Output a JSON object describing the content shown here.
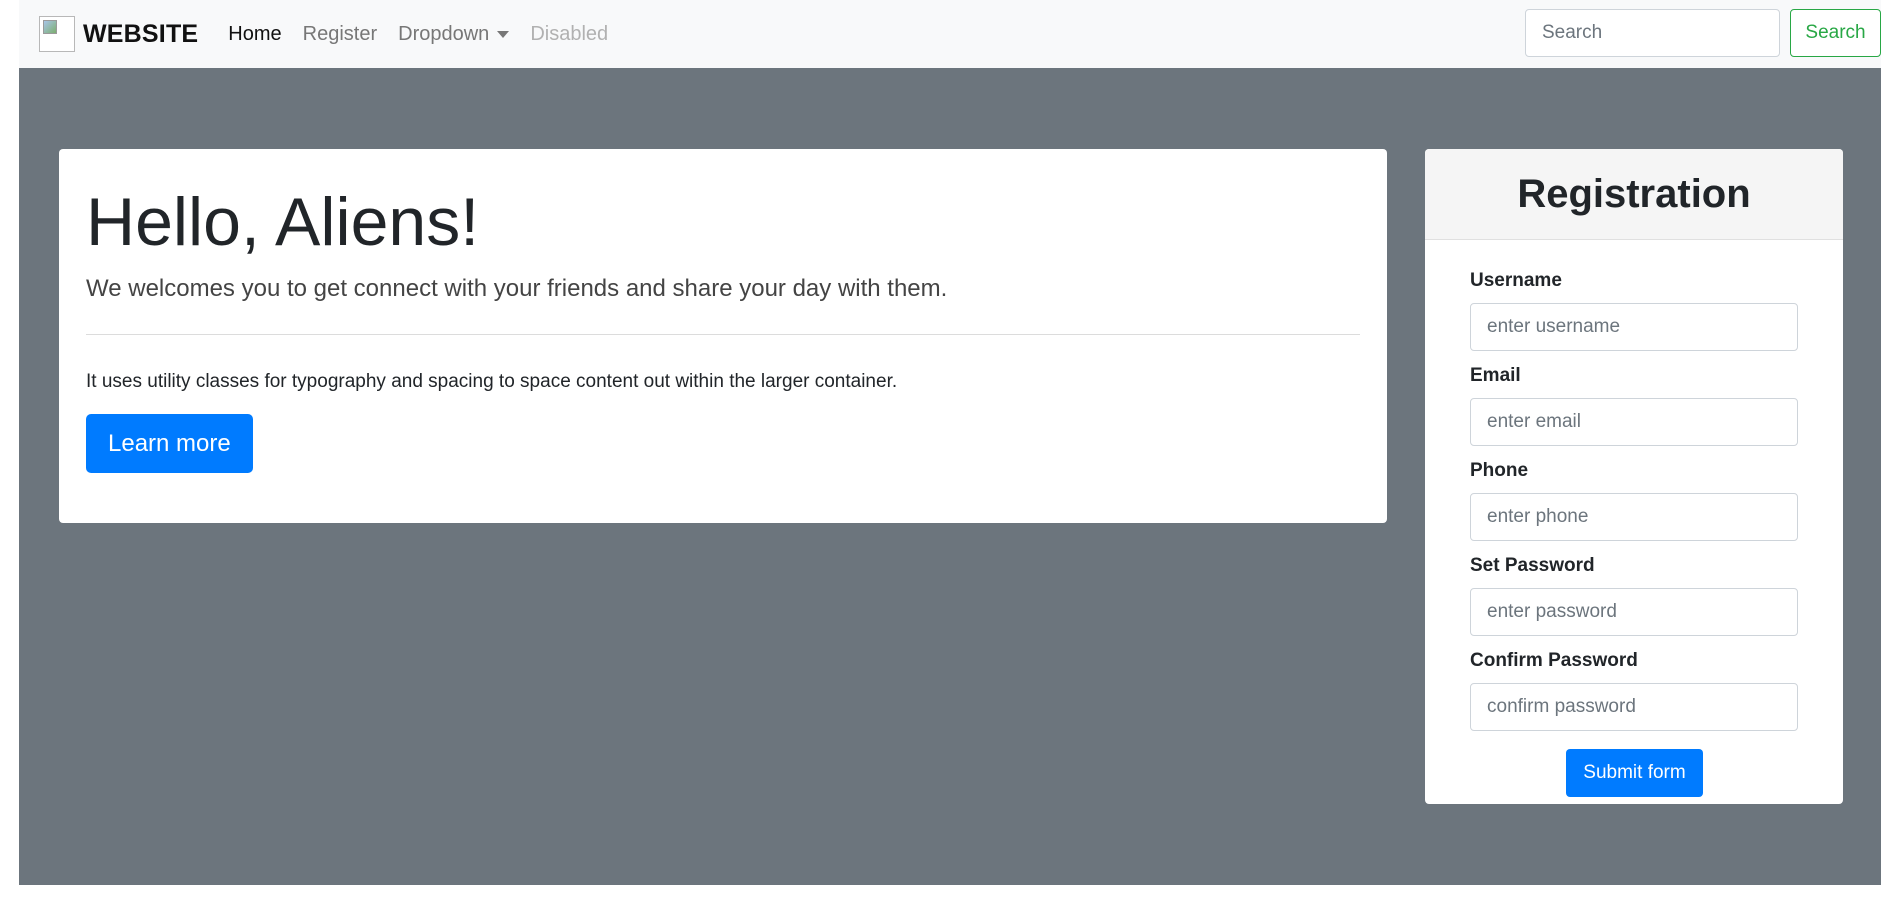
{
  "navbar": {
    "brand": "WEBSITE",
    "links": [
      {
        "label": "Home"
      },
      {
        "label": "Register"
      },
      {
        "label": "Dropdown"
      },
      {
        "label": "Disabled"
      }
    ],
    "search_placeholder": "Search",
    "search_button": "Search"
  },
  "jumbotron": {
    "title": "Hello, Aliens!",
    "lead": "We welcomes you to get connect with your friends and share your day with them.",
    "body": "It uses utility classes for typography and spacing to space content out within the larger container.",
    "button": "Learn more"
  },
  "registration": {
    "title": "Registration",
    "fields": [
      {
        "label": "Username",
        "placeholder": "enter username"
      },
      {
        "label": "Email",
        "placeholder": "enter email"
      },
      {
        "label": "Phone",
        "placeholder": "enter phone"
      },
      {
        "label": "Set Password",
        "placeholder": "enter password"
      },
      {
        "label": "Confirm Password",
        "placeholder": "confirm password"
      }
    ],
    "submit": "Submit form"
  },
  "colors": {
    "primary": "#007bff",
    "success": "#28a745",
    "background": "#6c757d",
    "navbar": "#f8f9fa"
  }
}
